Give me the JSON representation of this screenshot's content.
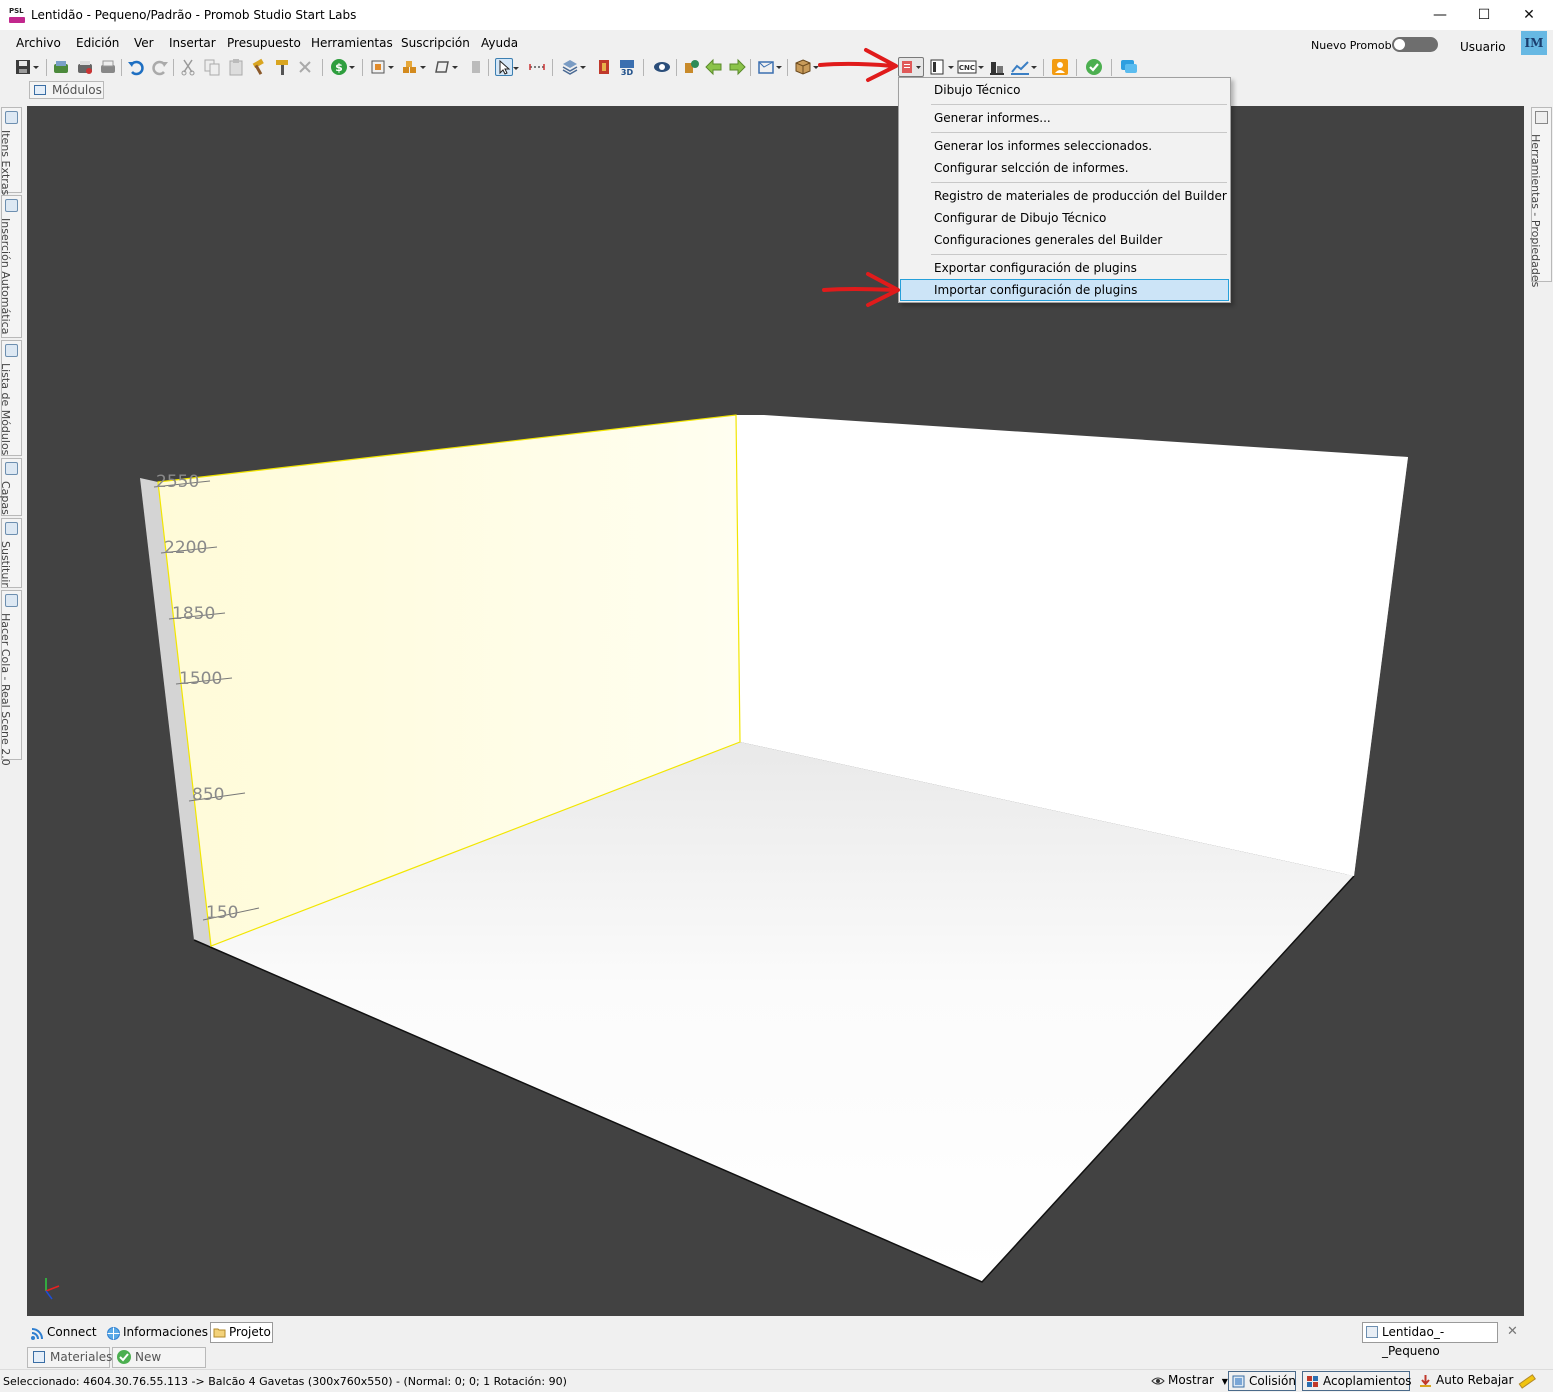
{
  "window": {
    "title": "Lentidão - Pequeno/Padrão - Promob Studio Start Labs",
    "app_icon_text": "PSL",
    "minimize": "—",
    "maximize": "☐",
    "close": "✕"
  },
  "menu": {
    "items": [
      "Archivo",
      "Edición",
      "Ver",
      "Insertar",
      "Presupuesto",
      "Herramientas",
      "Suscripción",
      "Ayuda"
    ],
    "nuevo_promob_label": "Nuevo Promob",
    "nuevo_promob_enabled": false,
    "user_label": "Usuario",
    "avatar_initials": "IM"
  },
  "toolbar": {
    "icons": [
      "save-icon",
      "cut-list-icon",
      "print-preview-icon",
      "print-icon",
      "undo-icon",
      "redo-icon",
      "cut-icon",
      "copy-icon",
      "paste-icon",
      "hammer-icon",
      "brush-icon",
      "delete-icon",
      "budget-icon",
      "modules-icon",
      "blocks-icon",
      "shape-icon",
      "select-icon",
      "measure-icon",
      "layers-icon",
      "wall-dimension-icon",
      "3d-icon",
      "view-icon",
      "render-icon",
      "back-icon",
      "forward-icon",
      "camera-icon",
      "box-icon",
      "reports-icon",
      "technical-drawing-icon",
      "cnc-icon",
      "production-icon",
      "chart-icon",
      "contact-icon",
      "check-icon",
      "chat-icon"
    ],
    "cnc_text": "CNC",
    "view_3d_text": "3D"
  },
  "panel": {
    "modulos_tab": "Módulos"
  },
  "left_sidebar": [
    "Itens Extras",
    "Inserción Automática",
    "Lista de Módulos",
    "Capas",
    "Sustituir",
    "Hacer Cola - Real Scene 2.0"
  ],
  "right_sidebar": [
    "Herramientas - Propiedades"
  ],
  "dropdown": {
    "items": [
      {
        "label": "Dibujo Técnico",
        "selected": false
      },
      {
        "label": "Generar informes...",
        "selected": false
      },
      {
        "label": "Generar los informes seleccionados.",
        "selected": false
      },
      {
        "label": "Configurar selcción de informes.",
        "selected": false
      },
      {
        "label": "Registro de materiales de producción del Builder",
        "selected": false
      },
      {
        "label": "Configurar de Dibujo Técnico",
        "selected": false
      },
      {
        "label": "Configuraciones generales del Builder",
        "selected": false
      },
      {
        "label": "Exportar configuración de plugins",
        "selected": false
      },
      {
        "label": "Importar configuración de plugins",
        "selected": true
      }
    ]
  },
  "viewport": {
    "wall_height_marks": [
      "2550",
      "2200",
      "1850",
      "1500",
      "850",
      "150"
    ],
    "background_color": "#424242",
    "selected_wall_color": "#fffde0",
    "selection_outline_color": "#f2e600",
    "annotation_arrow_color": "#e01b1b"
  },
  "bottom_tabs": {
    "items": [
      "Connect",
      "Informaciones",
      "Projeto"
    ],
    "active": "Projeto",
    "document_tab": "Lentidao_-_Pequeno",
    "document_close": "✕"
  },
  "secondary_tabs": [
    "Materiales",
    "New Auditor"
  ],
  "status": {
    "text": "Seleccionado: 4604.30.76.55.113 -> Balcão 4 Gavetas (300x760x550) - (Normal: 0; 0; 1 Rotación: 90)",
    "mostrar": "Mostrar",
    "colision": "Colisión",
    "acoplamientos": "Acoplamientos",
    "auto_rebajar": "Auto Rebajar"
  }
}
